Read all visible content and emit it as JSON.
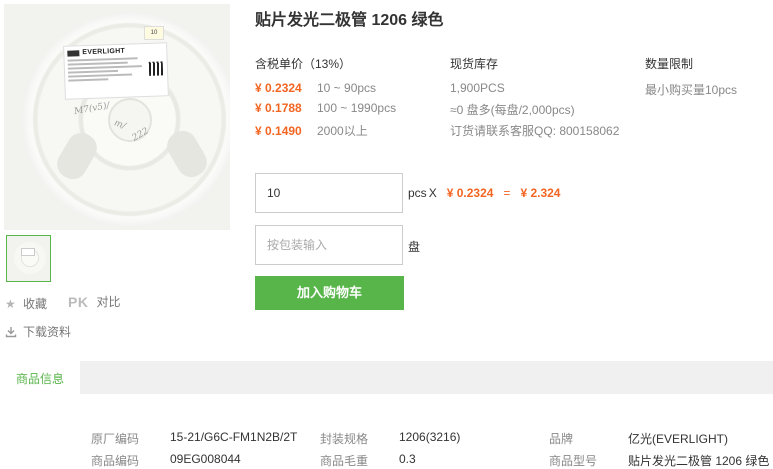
{
  "product": {
    "title": "贴片发光二极管 1206 绿色",
    "image_reel_tag": "10",
    "image_label_brand": "EVERLIGHT",
    "image_scrawl_1": "M7(v5)/",
    "image_scrawl_2": "m/",
    "image_scrawl_3": "222"
  },
  "side": {
    "favorite_label": "收藏",
    "pk_label": "PK",
    "compare_label": "对比",
    "download_label": "下载资料"
  },
  "pricing": {
    "header": "含税单价（13%）",
    "tiers": [
      {
        "price": "¥ 0.2324",
        "range": "10 ~ 90pcs"
      },
      {
        "price": "¥ 0.1788",
        "range": "100 ~ 1990pcs"
      },
      {
        "price": "¥ 0.1490",
        "range": "2000以上"
      }
    ]
  },
  "stock": {
    "header": "现货库存",
    "quantity": "1,900PCS",
    "reels": "≈0 盘多(每盘/2,000pcs)",
    "contact": "订货请联系客服QQ: 800158062"
  },
  "limit": {
    "header": "数量限制",
    "text": "最小购买量10pcs"
  },
  "order": {
    "qty_value": "10",
    "unit": "pcs",
    "times": "X",
    "unit_price": "¥ 0.2324",
    "equals": "=",
    "total": "¥ 2.324",
    "pack_placeholder": "按包装输入",
    "pack_unit": "盘",
    "add_to_cart": "加入购物车"
  },
  "tabs": {
    "active": "商品信息"
  },
  "specs": {
    "row1": [
      {
        "label": "原厂编码",
        "value": "15-21/G6C-FM1N2B/2T"
      },
      {
        "label": "封装规格",
        "value": "1206(3216)"
      },
      {
        "label": "品牌",
        "value": "亿光(EVERLIGHT)"
      }
    ],
    "row2": [
      {
        "label": "商品编码",
        "value": "09EG008044"
      },
      {
        "label": "商品毛重",
        "value": "0.3"
      },
      {
        "label": "商品型号",
        "value": "贴片发光二极管 1206 绿色"
      }
    ]
  },
  "colors": {
    "accent_green": "#58b54a",
    "price_orange": "#f26522"
  }
}
